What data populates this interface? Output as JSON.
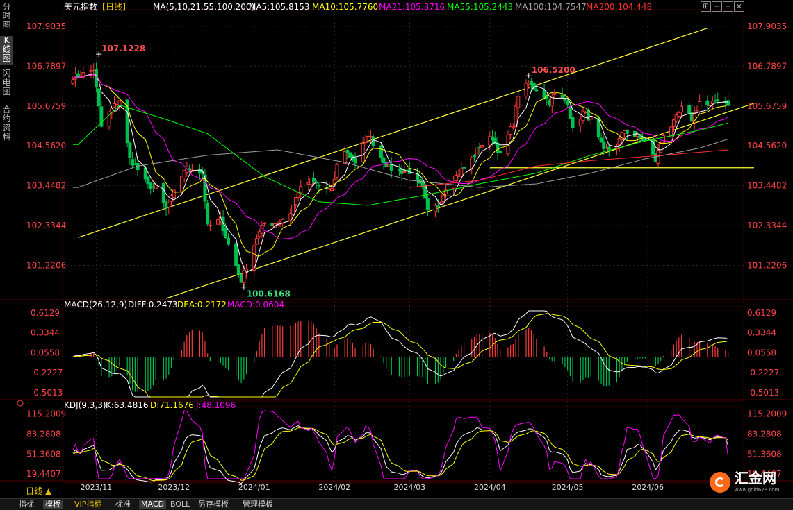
{
  "left_tabs": [
    {
      "label": "分时图",
      "active": false
    },
    {
      "label": "K线图",
      "active": true
    },
    {
      "label": "闪电图",
      "active": false
    },
    {
      "label": "合约资料",
      "active": false
    }
  ],
  "header": {
    "title": "美元指数",
    "period": "【日线】",
    "ma_params": "MA(5,10,21,55,100,200)",
    "ma5": "MA5:105.8153",
    "ma10": "MA10:105.7760",
    "ma21": "MA21:105.3716",
    "ma55": "MA55:105.2443",
    "ma100": "MA100:104.7547",
    "ma200": "MA200:104.448"
  },
  "price_ticks": [
    "107.9035",
    "106.7897",
    "105.6759",
    "104.5620",
    "103.4482",
    "102.3344",
    "101.2206"
  ],
  "annotations": {
    "high1": "107.1228",
    "high2": "106.5200",
    "low": "100.6168"
  },
  "macd_header": {
    "label": "MACD(26,12,9)",
    "diff": "DIFF:0.2473",
    "dea": "DEA:0.2172",
    "macd": "MACD:0.0604"
  },
  "macd_ticks": [
    "0.6129",
    "0.3344",
    "0.0558",
    "-0.2227",
    "-0.5013"
  ],
  "kdj_header": {
    "label": "KDJ(9,3,3)",
    "k": "K:63.4816",
    "d": "D:71.1676",
    "j": "J:48.1096"
  },
  "kdj_ticks": [
    "115.2009",
    "83.2808",
    "51.3608",
    "19.4407"
  ],
  "date_ticks": [
    "2023/11",
    "2023/12",
    "2024/01",
    "2024/02",
    "2024/03",
    "2024/04",
    "2024/05",
    "2024/06"
  ],
  "period_badge": "日线 ▲",
  "bottom_tabs": [
    {
      "label": "指标",
      "active": false,
      "vip": false
    },
    {
      "label": "模板",
      "active": true,
      "vip": false
    },
    {
      "label": "VIP指标",
      "active": false,
      "vip": true
    },
    {
      "label": "标准",
      "active": false,
      "vip": false
    },
    {
      "label": "MACD",
      "active": true,
      "vip": false
    },
    {
      "label": "BOLL",
      "active": false,
      "vip": false
    },
    {
      "label": "另存模板",
      "active": false,
      "vip": false
    },
    {
      "label": "管理模板",
      "active": false,
      "vip": false
    }
  ],
  "logo": {
    "name": "汇金网",
    "url": "www.gold678.com"
  },
  "colors": {
    "up": "#ff3b3b",
    "down": "#00c050",
    "ma5": "#ffffff",
    "ma10": "#ffff00",
    "ma21": "#ff00ff",
    "ma55": "#00ff00",
    "ma100": "#a0a0a0",
    "ma200": "#ff3030",
    "trend": "#ffff33",
    "price_axis": "#ff4444",
    "grid": "#2a2a2a"
  },
  "chart_data": {
    "type": "candlestick",
    "title": "美元指数 日线",
    "y_range": [
      100.3,
      108.25
    ],
    "series_anchors": {
      "close": [
        [
          "2023-10-25",
          106.5
        ],
        [
          "2023-10-31",
          106.7
        ],
        [
          "2023-11-03",
          105.1
        ],
        [
          "2023-11-07",
          105.6
        ],
        [
          "2023-11-10",
          105.85
        ],
        [
          "2023-11-14",
          104.2
        ],
        [
          "2023-11-17",
          103.9
        ],
        [
          "2023-11-21",
          103.45
        ],
        [
          "2023-11-24",
          103.4
        ],
        [
          "2023-11-28",
          102.8
        ],
        [
          "2023-12-01",
          103.25
        ],
        [
          "2023-12-05",
          103.9
        ],
        [
          "2023-12-08",
          103.95
        ],
        [
          "2023-12-12",
          103.8
        ],
        [
          "2023-12-14",
          102.3
        ],
        [
          "2023-12-19",
          102.5
        ],
        [
          "2023-12-22",
          101.8
        ],
        [
          "2023-12-27",
          100.8
        ],
        [
          "2024-01-02",
          102.0
        ],
        [
          "2024-01-05",
          102.4
        ],
        [
          "2024-01-10",
          102.4
        ],
        [
          "2024-01-15",
          102.7
        ],
        [
          "2024-01-18",
          103.3
        ],
        [
          "2024-01-23",
          103.6
        ],
        [
          "2024-01-26",
          103.45
        ],
        [
          "2024-01-31",
          103.3
        ],
        [
          "2024-02-02",
          104.0
        ],
        [
          "2024-02-05",
          104.45
        ],
        [
          "2024-02-09",
          104.1
        ],
        [
          "2024-02-14",
          104.9
        ],
        [
          "2024-02-19",
          104.25
        ],
        [
          "2024-02-22",
          103.95
        ],
        [
          "2024-02-27",
          103.85
        ],
        [
          "2024-03-01",
          103.85
        ],
        [
          "2024-03-06",
          103.35
        ],
        [
          "2024-03-08",
          102.7
        ],
        [
          "2024-03-12",
          102.9
        ],
        [
          "2024-03-15",
          103.4
        ],
        [
          "2024-03-20",
          103.8
        ],
        [
          "2024-03-25",
          104.2
        ],
        [
          "2024-03-28",
          104.55
        ],
        [
          "2024-04-02",
          104.8
        ],
        [
          "2024-04-05",
          104.3
        ],
        [
          "2024-04-10",
          105.2
        ],
        [
          "2024-04-12",
          106.0
        ],
        [
          "2024-04-16",
          106.3
        ],
        [
          "2024-04-19",
          106.15
        ],
        [
          "2024-04-24",
          105.8
        ],
        [
          "2024-04-26",
          106.0
        ],
        [
          "2024-05-01",
          105.8
        ],
        [
          "2024-05-03",
          105.0
        ],
        [
          "2024-05-07",
          105.5
        ],
        [
          "2024-05-10",
          105.3
        ],
        [
          "2024-05-15",
          104.4
        ],
        [
          "2024-05-20",
          104.6
        ],
        [
          "2024-05-23",
          105.0
        ],
        [
          "2024-05-28",
          104.8
        ],
        [
          "2024-05-31",
          104.7
        ],
        [
          "2024-06-04",
          104.15
        ],
        [
          "2024-06-07",
          104.9
        ],
        [
          "2024-06-11",
          105.2
        ],
        [
          "2024-06-14",
          105.6
        ],
        [
          "2024-06-18",
          105.3
        ],
        [
          "2024-06-21",
          105.8
        ],
        [
          "2024-06-25",
          105.65
        ],
        [
          "2024-06-28",
          105.9
        ],
        [
          "2024-07-02",
          105.75
        ]
      ],
      "ma55": [
        [
          "2023-10-25",
          104.6
        ],
        [
          "2023-11-10",
          105.7
        ],
        [
          "2023-11-28",
          105.3
        ],
        [
          "2023-12-14",
          104.9
        ],
        [
          "2024-01-05",
          103.7
        ],
        [
          "2024-01-26",
          103.0
        ],
        [
          "2024-02-14",
          102.9
        ],
        [
          "2024-03-08",
          103.2
        ],
        [
          "2024-03-28",
          103.5
        ],
        [
          "2024-04-19",
          103.8
        ],
        [
          "2024-05-10",
          104.3
        ],
        [
          "2024-05-31",
          104.7
        ],
        [
          "2024-06-21",
          105.0
        ],
        [
          "2024-07-02",
          105.2
        ]
      ],
      "ma100": [
        [
          "2023-10-25",
          103.4
        ],
        [
          "2023-11-17",
          104.0
        ],
        [
          "2023-12-14",
          104.3
        ],
        [
          "2024-01-10",
          104.45
        ],
        [
          "2024-02-05",
          104.1
        ],
        [
          "2024-03-01",
          103.6
        ],
        [
          "2024-03-28",
          103.4
        ],
        [
          "2024-04-19",
          103.5
        ],
        [
          "2024-05-10",
          103.8
        ],
        [
          "2024-05-31",
          104.2
        ],
        [
          "2024-06-21",
          104.5
        ],
        [
          "2024-07-02",
          104.75
        ]
      ],
      "ma200": [
        [
          "2024-03-01",
          103.4
        ],
        [
          "2024-03-28",
          103.6
        ],
        [
          "2024-04-19",
          104.0
        ],
        [
          "2024-05-10",
          104.15
        ],
        [
          "2024-06-07",
          104.3
        ],
        [
          "2024-07-02",
          104.45
        ]
      ]
    },
    "trendlines": [
      {
        "from": [
          "2023-10-25",
          102.0
        ],
        "to": [
          "2024-06-24",
          107.85
        ]
      },
      {
        "from": [
          "2023-11-28",
          100.3
        ],
        "to": [
          "2024-07-12",
          105.75
        ]
      },
      {
        "from": [
          "2024-04-01",
          103.95
        ],
        "to": [
          "2024-07-12",
          103.95
        ]
      }
    ],
    "price_labels": [
      {
        "text": "107.1228",
        "date": "2023-11-02",
        "value": 107.1228
      },
      {
        "text": "106.5200",
        "date": "2024-04-16",
        "value": 106.52
      },
      {
        "text": "100.6168",
        "date": "2023-12-28",
        "value": 100.6168
      }
    ],
    "macd": {
      "y_range": [
        -0.56,
        0.64
      ],
      "diff_last": 0.2473,
      "dea_last": 0.2172,
      "macd_last": 0.0604
    },
    "kdj": {
      "y_range": [
        12,
        120
      ],
      "k_last": 63.4816,
      "d_last": 71.1676,
      "j_last": 48.1096
    }
  }
}
